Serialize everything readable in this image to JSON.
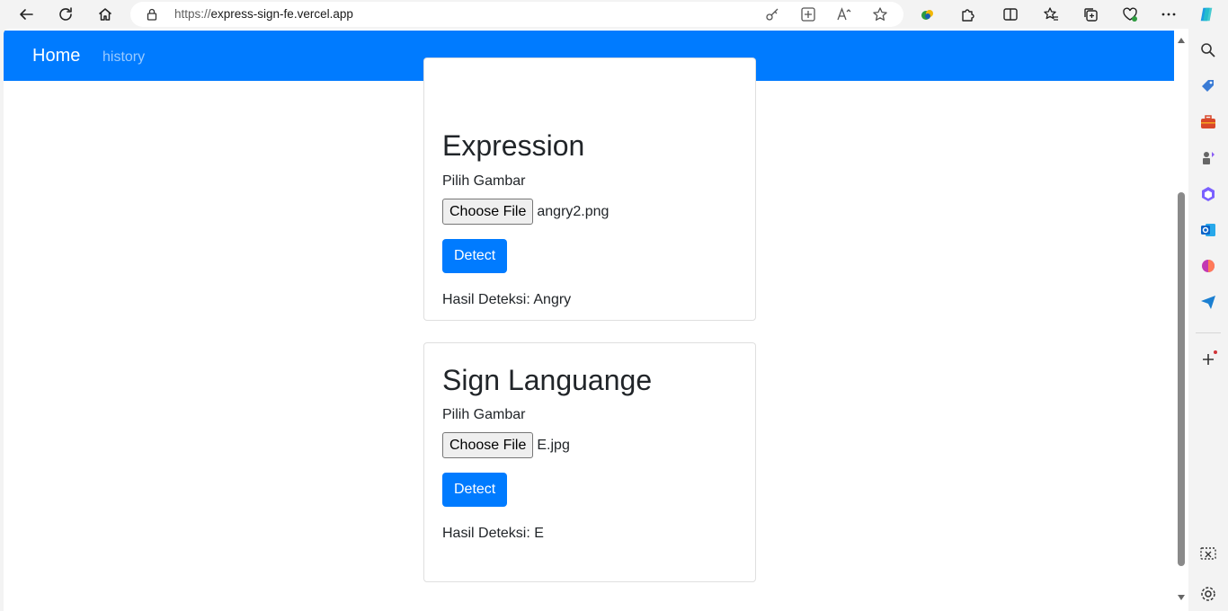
{
  "browser": {
    "url_scheme": "https://",
    "url_host": "express-sign-fe.vercel.app"
  },
  "navbar": {
    "brand": "Home",
    "links": [
      "history"
    ]
  },
  "cards": [
    {
      "title": "Expression",
      "input_label": "Pilih Gambar",
      "file_button": "Choose File",
      "file_name": "angry2.png",
      "detect_label": "Detect",
      "result": "Hasil Deteksi: Angry"
    },
    {
      "title": "Sign Languange",
      "input_label": "Pilih Gambar",
      "file_button": "Choose File",
      "file_name": "E.jpg",
      "detect_label": "Detect",
      "result": "Hasil Deteksi: E"
    }
  ],
  "colors": {
    "primary": "#007bff",
    "text": "#212529"
  }
}
